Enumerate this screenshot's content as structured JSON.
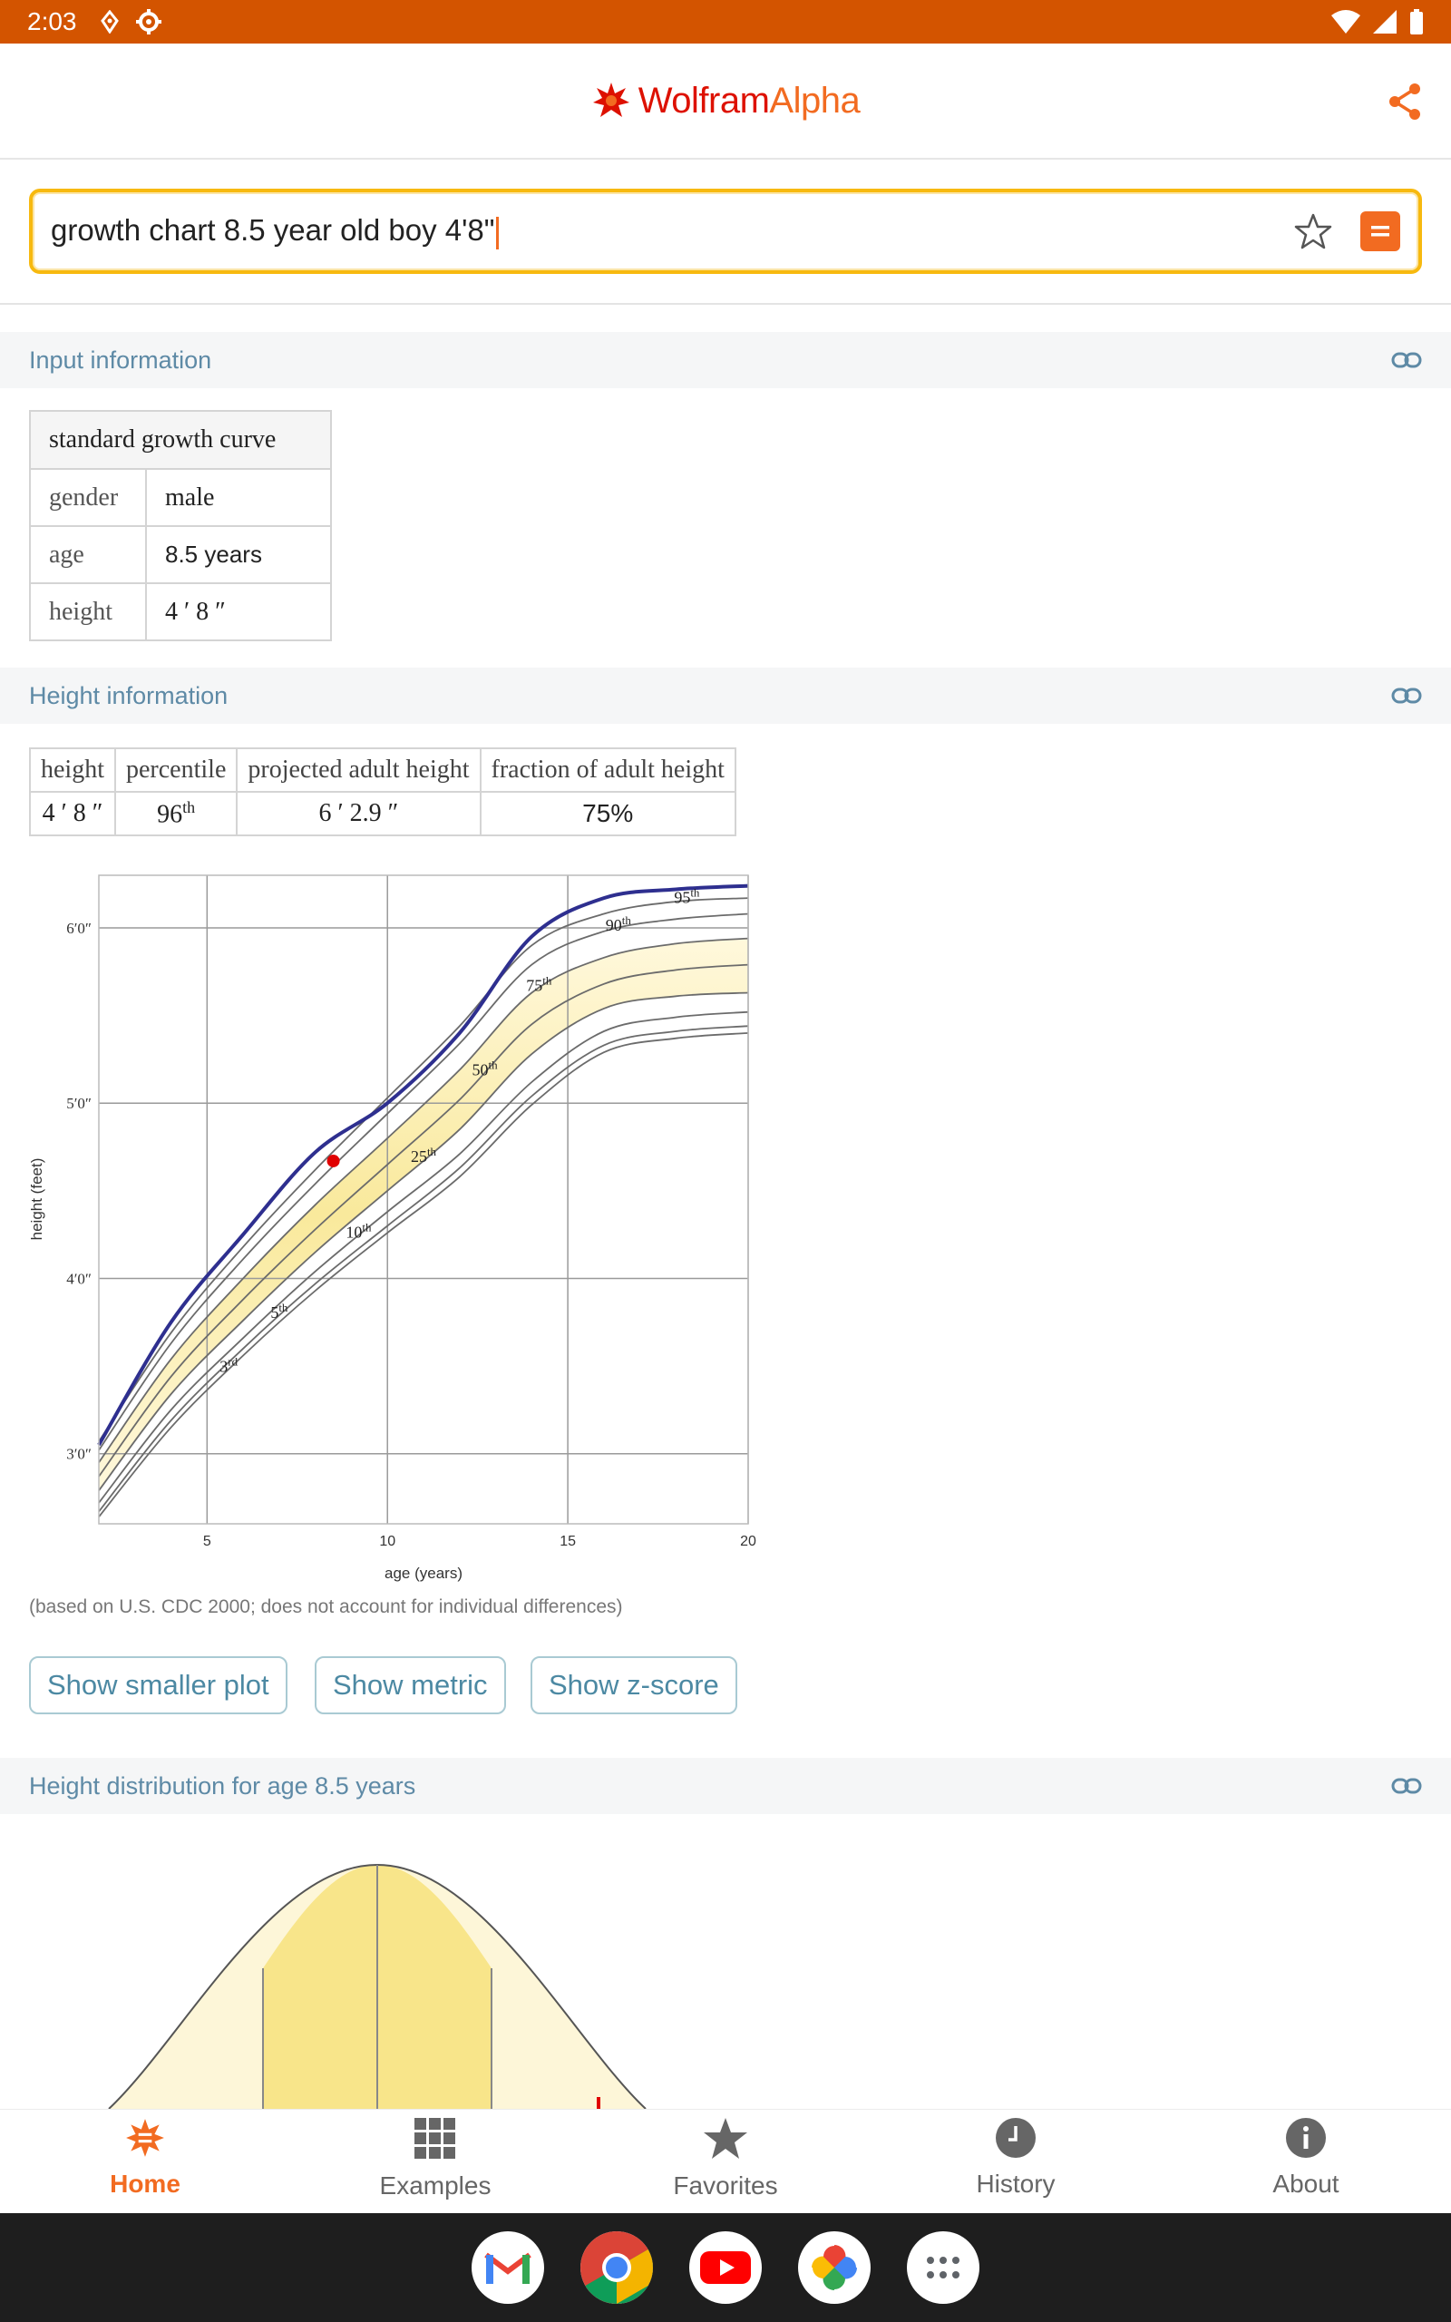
{
  "status_bar": {
    "time": "2:03"
  },
  "header": {
    "logo_wolfram": "Wolfram",
    "logo_alpha": "Alpha"
  },
  "search": {
    "query": "growth chart 8.5 year old boy 4'8\""
  },
  "pods": {
    "input": {
      "title": "Input information"
    },
    "height": {
      "title": "Height information"
    },
    "distribution": {
      "title": "Height distribution for age 8.5 years"
    }
  },
  "input_table": {
    "title": "standard growth curve",
    "rows": [
      {
        "key": "gender",
        "value": "male"
      },
      {
        "key": "age",
        "value": "8.5 years"
      },
      {
        "key": "height",
        "value": "4 ′ 8 ″"
      }
    ]
  },
  "height_table": {
    "headers": [
      "height",
      "percentile",
      "projected adult height",
      "fraction of adult height"
    ],
    "height": "4 ′ 8 ″",
    "percentile": "96",
    "percentile_suffix": "th",
    "projected": "6 ′ 2.9 ″",
    "fraction": "75%"
  },
  "chart_data": {
    "type": "line",
    "xlabel": "age (years)",
    "ylabel": "height (feet)",
    "xlim": [
      2,
      20
    ],
    "ylim": [
      2.6,
      6.3
    ],
    "x_ticks": [
      5,
      10,
      15,
      20
    ],
    "y_ticks": [
      {
        "value": 3,
        "label": "3′0″"
      },
      {
        "value": 4,
        "label": "4′0″"
      },
      {
        "value": 5,
        "label": "5′0″"
      },
      {
        "value": 6,
        "label": "6′0″"
      }
    ],
    "grid": true,
    "ages": [
      2,
      4,
      6,
      8,
      10,
      12,
      14,
      16,
      18,
      20
    ],
    "series": [
      {
        "name": "3",
        "suffix": "rd",
        "values": [
          2.64,
          3.15,
          3.56,
          3.93,
          4.26,
          4.58,
          4.99,
          5.29,
          5.37,
          5.4
        ],
        "label_age": 5.6
      },
      {
        "name": "5",
        "suffix": "th",
        "values": [
          2.67,
          3.19,
          3.6,
          3.97,
          4.3,
          4.63,
          5.04,
          5.33,
          5.41,
          5.44
        ],
        "label_age": 7.0
      },
      {
        "name": "10",
        "suffix": "th",
        "values": [
          2.72,
          3.25,
          3.66,
          4.04,
          4.38,
          4.71,
          5.12,
          5.41,
          5.49,
          5.52
        ],
        "label_age": 9.2
      },
      {
        "name": "25",
        "suffix": "th",
        "values": [
          2.79,
          3.34,
          3.76,
          4.15,
          4.5,
          4.85,
          5.28,
          5.54,
          5.61,
          5.63
        ],
        "label_age": 11.0
      },
      {
        "name": "50",
        "suffix": "th",
        "values": [
          2.87,
          3.44,
          3.88,
          4.28,
          4.65,
          5.02,
          5.45,
          5.68,
          5.76,
          5.79
        ],
        "label_age": 12.7
      },
      {
        "name": "75",
        "suffix": "th",
        "values": [
          2.95,
          3.54,
          4.0,
          4.42,
          4.8,
          5.19,
          5.63,
          5.83,
          5.91,
          5.94
        ],
        "label_age": 14.2
      },
      {
        "name": "90",
        "suffix": "th",
        "values": [
          3.02,
          3.63,
          4.11,
          4.54,
          4.94,
          5.34,
          5.79,
          5.98,
          6.05,
          6.08
        ],
        "label_age": 16.4
      },
      {
        "name": "95",
        "suffix": "th",
        "values": [
          3.07,
          3.69,
          4.18,
          4.62,
          5.03,
          5.44,
          5.9,
          6.08,
          6.15,
          6.17
        ],
        "label_age": 18.3
      }
    ],
    "projection_series": {
      "values": [
        3.05,
        3.75,
        4.25,
        4.72,
        5.0,
        5.4,
        5.95,
        6.17,
        6.22,
        6.24
      ]
    },
    "point": {
      "age": 8.5,
      "height": 4.67
    }
  },
  "chart_note": "(based on U.S. CDC 2000; does not account for individual differences)",
  "buttons": {
    "smaller": "Show smaller plot",
    "metric": "Show metric",
    "zscore": "Show z-score"
  },
  "bottom_nav": {
    "items": [
      {
        "label": "Home"
      },
      {
        "label": "Examples"
      },
      {
        "label": "Favorites"
      },
      {
        "label": "History"
      },
      {
        "label": "About"
      }
    ]
  },
  "colors": {
    "accent": "#f26b21",
    "status_bar": "#d35400",
    "pod_title": "#5e8aa6",
    "projection_line": "#2e2f8f",
    "point": "#e00000",
    "band": "#f8e58a"
  }
}
